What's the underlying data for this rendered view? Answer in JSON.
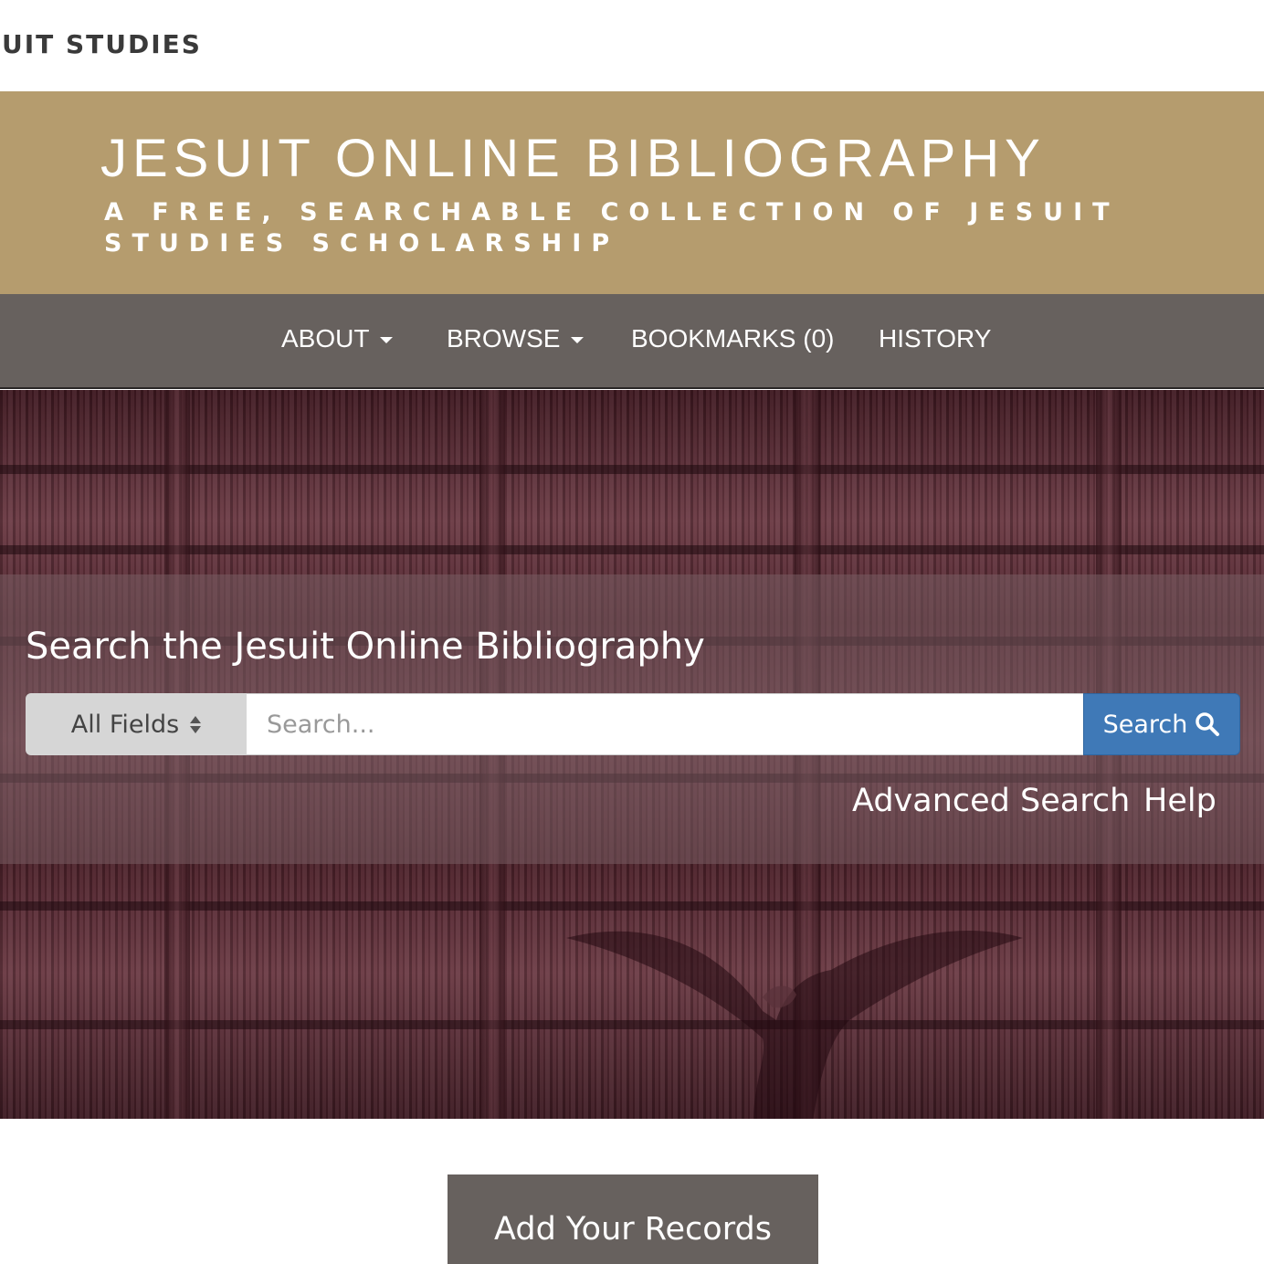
{
  "top_brand": "UIT STUDIES",
  "masthead": {
    "title": "JESUIT ONLINE BIBLIOGRAPHY",
    "subtitle": "A FREE, SEARCHABLE COLLECTION OF JESUIT STUDIES SCHOLARSHIP"
  },
  "nav": {
    "items": [
      {
        "label": "ABOUT",
        "has_dropdown": true
      },
      {
        "label": "BROWSE",
        "has_dropdown": true
      },
      {
        "label": "BOOKMARKS (0)",
        "has_dropdown": false
      },
      {
        "label": "HISTORY",
        "has_dropdown": false
      }
    ]
  },
  "search": {
    "heading": "Search the Jesuit Online Bibliography",
    "field_selected": "All Fields",
    "placeholder": "Search...",
    "button_label": "Search",
    "button_icon": "magnifier-icon",
    "advanced_label": "Advanced Search",
    "help_label": "Help"
  },
  "add_records_label": "Add Your Records",
  "colors": {
    "masthead_gold": "#b59c6e",
    "nav_gray": "#67615e",
    "hero_maroon": "#5a2a33",
    "search_blue": "#3f79b7"
  }
}
